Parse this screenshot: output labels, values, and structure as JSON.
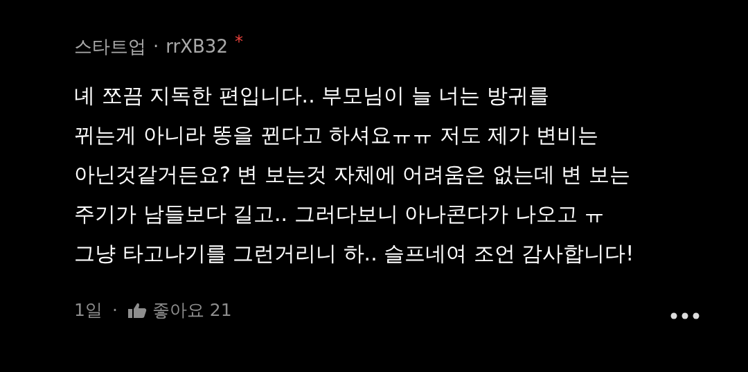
{
  "comment": {
    "category": "스타트업",
    "separator": "·",
    "author": "rrXB32",
    "author_mark": "*",
    "lines": [
      "녜 쪼끔 지독한 편입니다.. 부모님이 늘 너는 방귀를",
      "뀌는게 아니라 똥을 뀐다고 하셔요ㅠㅠ 저도 제가 변비는",
      "아닌것같거든요? 변 보는것 자체에 어려움은 없는데 변 보는",
      "주기가 남들보다 길고.. 그러다보니 아나콘다가 나오고 ㅠ",
      "그냥 타고나기를 그런거리니 하.. 슬프네여 조언 감사합니다!"
    ],
    "time": "1일",
    "footer_separator": "·",
    "like_label": "좋아요 21"
  }
}
